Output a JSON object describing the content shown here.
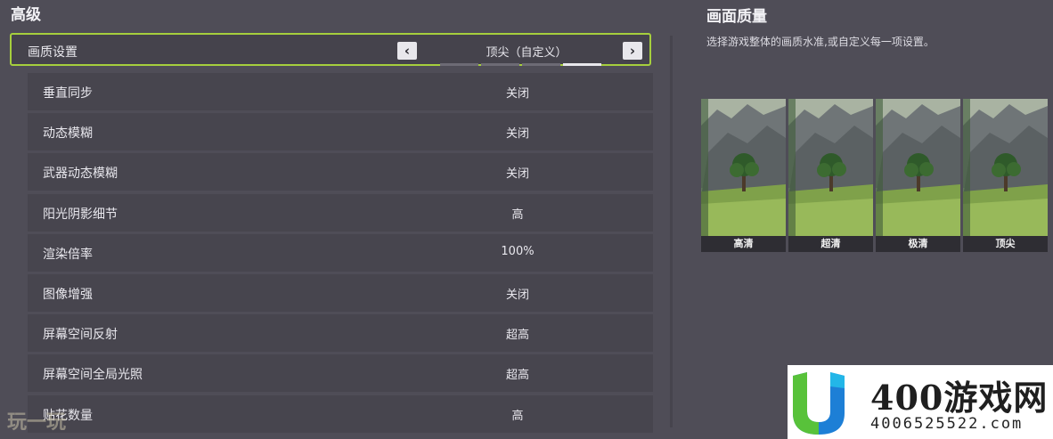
{
  "section": {
    "title": "高级"
  },
  "quality": {
    "label": "画质设置",
    "value": "顶尖（自定义）",
    "prev_icon": "chevron-left-icon",
    "next_icon": "chevron-right-icon",
    "levels_total": 4,
    "level_selected": 4
  },
  "settings": [
    {
      "name": "垂直同步",
      "value": "关闭"
    },
    {
      "name": "动态模糊",
      "value": "关闭"
    },
    {
      "name": "武器动态模糊",
      "value": "关闭"
    },
    {
      "name": "阳光阴影细节",
      "value": "高"
    },
    {
      "name": "渲染倍率",
      "value": "100%"
    },
    {
      "name": "图像增强",
      "value": "关闭"
    },
    {
      "name": "屏幕空间反射",
      "value": "超高"
    },
    {
      "name": "屏幕空间全局光照",
      "value": "超高"
    },
    {
      "name": "贴花数量",
      "value": "高"
    }
  ],
  "panel": {
    "title": "画面质量",
    "description": "选择游戏整体的画质水准,或自定义每一项设置。",
    "previews": [
      {
        "caption": "高清"
      },
      {
        "caption": "超清"
      },
      {
        "caption": "极清"
      },
      {
        "caption": "顶尖"
      }
    ]
  },
  "watermark": {
    "left_text": "玩一玩",
    "brand_name": "400游戏网",
    "brand_url": "4006525522.com"
  },
  "colors": {
    "accent": "#a6cf3d",
    "background": "#4f4d57",
    "row": "#47454e"
  }
}
